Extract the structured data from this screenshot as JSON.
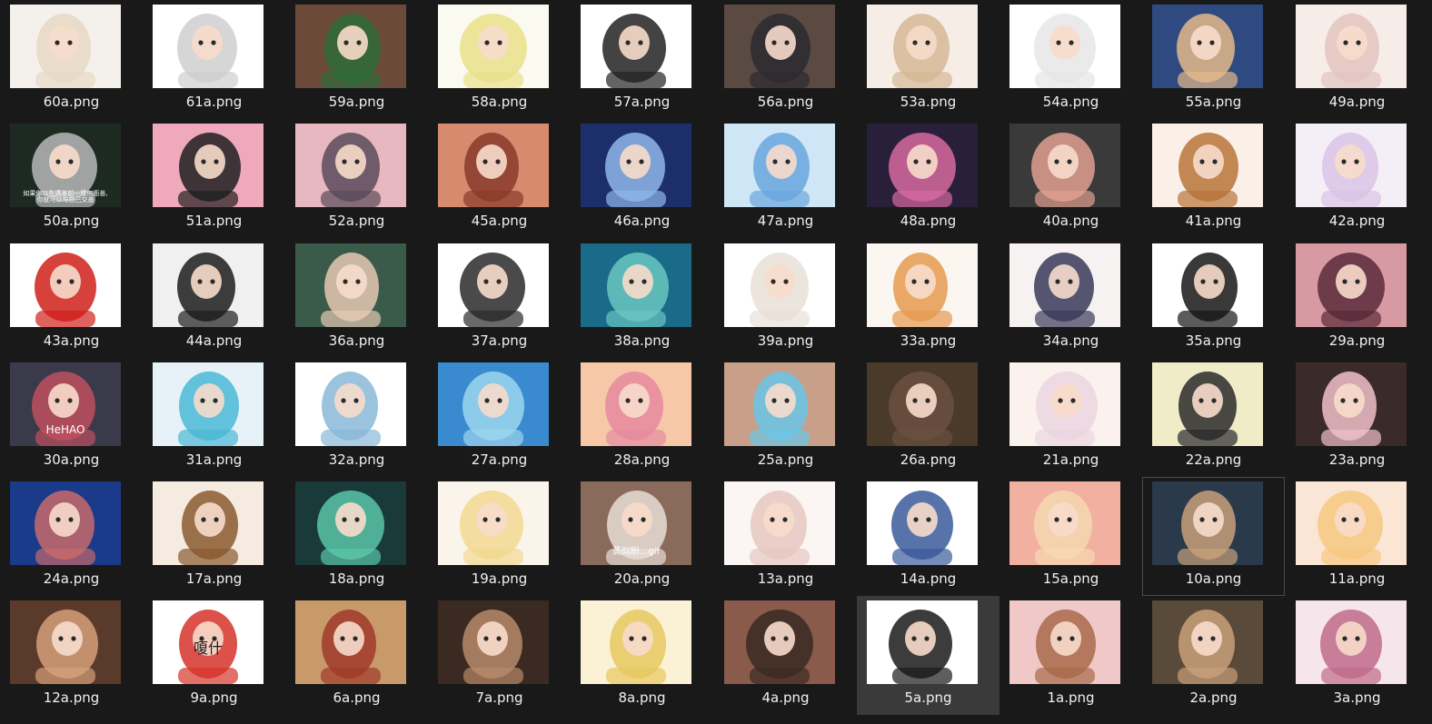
{
  "files": [
    {
      "name": "60a.png",
      "bg": "#f4f0ec",
      "fg": "#e8d8c6"
    },
    {
      "name": "61a.png",
      "bg": "#ffffff",
      "fg": "#cfcfcf"
    },
    {
      "name": "59a.png",
      "bg": "#6b4a3a",
      "fg": "#2e6b3a"
    },
    {
      "name": "58a.png",
      "bg": "#fbfaf0",
      "fg": "#e9e08a"
    },
    {
      "name": "57a.png",
      "bg": "#ffffff",
      "fg": "#222222"
    },
    {
      "name": "56a.png",
      "bg": "#5a4a42",
      "fg": "#2c2a30"
    },
    {
      "name": "53a.png",
      "bg": "#f6eee6",
      "fg": "#d6b894"
    },
    {
      "name": "54a.png",
      "bg": "#ffffff",
      "fg": "#e6e6e6"
    },
    {
      "name": "55a.png",
      "bg": "#2f4a80",
      "fg": "#e3b88a"
    },
    {
      "name": "49a.png",
      "bg": "#f6ece8",
      "fg": "#e3c4c0"
    },
    {
      "name": "50a.png",
      "bg": "#1d2a22",
      "fg": "#b9b9b9"
    },
    {
      "name": "51a.png",
      "bg": "#f0a8bd",
      "fg": "#1f1f1f"
    },
    {
      "name": "52a.png",
      "bg": "#e7b8c0",
      "fg": "#5a4a5a"
    },
    {
      "name": "45a.png",
      "bg": "#d68b6e",
      "fg": "#8a3a2a"
    },
    {
      "name": "46a.png",
      "bg": "#1d2f6a",
      "fg": "#8fb6e8"
    },
    {
      "name": "47a.png",
      "bg": "#cfe6f6",
      "fg": "#6aa6de"
    },
    {
      "name": "48a.png",
      "bg": "#2a1f3a",
      "fg": "#d66aa0"
    },
    {
      "name": "40a.png",
      "bg": "#3a3a3a",
      "fg": "#e0a090"
    },
    {
      "name": "41a.png",
      "bg": "#fbf0e8",
      "fg": "#b8743a"
    },
    {
      "name": "42a.png",
      "bg": "#f4eef6",
      "fg": "#d8c4e6"
    },
    {
      "name": "43a.png",
      "bg": "#ffffff",
      "fg": "#d0201a"
    },
    {
      "name": "44a.png",
      "bg": "#f0f0f0",
      "fg": "#1c1c1c"
    },
    {
      "name": "36a.png",
      "bg": "#3a5a4a",
      "fg": "#e6c8b2"
    },
    {
      "name": "37a.png",
      "bg": "#ffffff",
      "fg": "#2a2a2a"
    },
    {
      "name": "38a.png",
      "bg": "#1a6a8a",
      "fg": "#6ac6c0"
    },
    {
      "name": "39a.png",
      "bg": "#ffffff",
      "fg": "#e8e0d8"
    },
    {
      "name": "33a.png",
      "bg": "#fbf6f0",
      "fg": "#e69a50"
    },
    {
      "name": "34a.png",
      "bg": "#f6f2f2",
      "fg": "#3a3a5a"
    },
    {
      "name": "35a.png",
      "bg": "#ffffff",
      "fg": "#161616"
    },
    {
      "name": "29a.png",
      "bg": "#d89aa2",
      "fg": "#5a2a3a"
    },
    {
      "name": "30a.png",
      "bg": "#3a3a4a",
      "fg": "#c05060"
    },
    {
      "name": "31a.png",
      "bg": "#e6f2f8",
      "fg": "#4ab8d6"
    },
    {
      "name": "32a.png",
      "bg": "#ffffff",
      "fg": "#8ab8d8"
    },
    {
      "name": "27a.png",
      "bg": "#3a8ad0",
      "fg": "#9cd6f0"
    },
    {
      "name": "28a.png",
      "bg": "#f6c8a8",
      "fg": "#e68aa0"
    },
    {
      "name": "25a.png",
      "bg": "#c8a08a",
      "fg": "#6ac6e6"
    },
    {
      "name": "26a.png",
      "bg": "#4a3a2a",
      "fg": "#6a5040"
    },
    {
      "name": "21a.png",
      "bg": "#fbf2ee",
      "fg": "#ead6e0"
    },
    {
      "name": "22a.png",
      "bg": "#f0ecc8",
      "fg": "#2a2a2a"
    },
    {
      "name": "23a.png",
      "bg": "#3a2a2a",
      "fg": "#f0c0c8"
    },
    {
      "name": "24a.png",
      "bg": "#1a3a8a",
      "fg": "#c86a6a"
    },
    {
      "name": "17a.png",
      "bg": "#f6ebe0",
      "fg": "#8a5a30"
    },
    {
      "name": "18a.png",
      "bg": "#1a3a3a",
      "fg": "#5ac6a8"
    },
    {
      "name": "19a.png",
      "bg": "#fbf4ea",
      "fg": "#f2d890"
    },
    {
      "name": "20a.png",
      "bg": "#8a6a5a",
      "fg": "#e6ddd6"
    },
    {
      "name": "13a.png",
      "bg": "#fbf6f4",
      "fg": "#e6c8c0"
    },
    {
      "name": "14a.png",
      "bg": "#ffffff",
      "fg": "#3a5a9a"
    },
    {
      "name": "15a.png",
      "bg": "#f2b0a0",
      "fg": "#f6d8b0"
    },
    {
      "name": "10a.png",
      "bg": "#2a3a4a",
      "fg": "#c8a07a"
    },
    {
      "name": "11a.png",
      "bg": "#fbe6d6",
      "fg": "#f6c880"
    },
    {
      "name": "12a.png",
      "bg": "#5a3a2a",
      "fg": "#d6a07a"
    },
    {
      "name": "9a.png",
      "bg": "#ffffff",
      "fg": "#d6342a"
    },
    {
      "name": "6a.png",
      "bg": "#c89a6a",
      "fg": "#a03a2a"
    },
    {
      "name": "7a.png",
      "bg": "#3a2a22",
      "fg": "#b88a6a"
    },
    {
      "name": "8a.png",
      "bg": "#fbf2d6",
      "fg": "#e6c860"
    },
    {
      "name": "4a.png",
      "bg": "#8a5a4a",
      "fg": "#3a2a22"
    },
    {
      "name": "5a.png",
      "bg": "#ffffff",
      "fg": "#1a1a1a"
    },
    {
      "name": "1a.png",
      "bg": "#f0c8c8",
      "fg": "#a86a4a"
    },
    {
      "name": "2a.png",
      "bg": "#5a4a3a",
      "fg": "#c8a07a"
    },
    {
      "name": "3a.png",
      "bg": "#f6e6ec",
      "fg": "#c06a8a"
    }
  ],
  "state": {
    "hovered": "10a.png",
    "selected": "5a.png"
  },
  "thumb_texts": {
    "50a_caption_line1": "如果你以先遇善前一樣何衝善,",
    "50a_caption_line2": "你就可以与自己交善",
    "30a_logo": "HeHAO",
    "20a_caption": "蒸似盼...gif",
    "9a_caption": "嗄什"
  }
}
